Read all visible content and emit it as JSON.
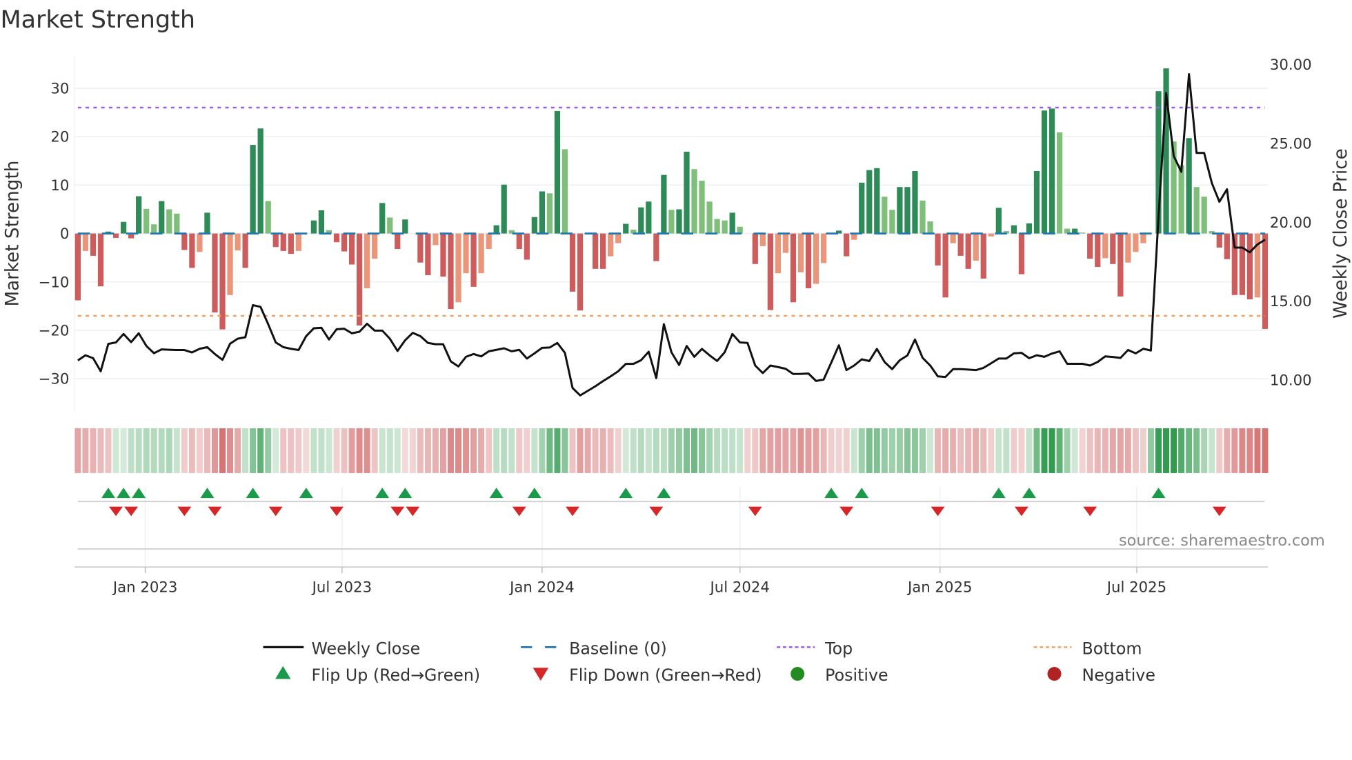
{
  "chart_data": {
    "type": "bar",
    "title": "Market Strength",
    "ylabel": "Market Strength",
    "y2label": "Weekly Close Price",
    "ylim": [
      -36.7,
      36.7
    ],
    "y2lim": [
      8.0,
      30.5
    ],
    "yticks": [
      30,
      20,
      10,
      0,
      -10,
      -20,
      -30
    ],
    "ytick_labels": [
      "30",
      "20",
      "10",
      "0",
      "−10",
      "−20",
      "−30"
    ],
    "y2ticks": [
      30,
      25,
      20,
      15,
      10
    ],
    "y2tick_labels": [
      "30.00",
      "25.00",
      "20.00",
      "15.00",
      "10.00"
    ],
    "x_start_date": "2022-10-31",
    "x_interval_days": 7,
    "xticks": [
      {
        "date": "2023-01-01",
        "label": "Jan 2023"
      },
      {
        "date": "2023-07-01",
        "label": "Jul 2023"
      },
      {
        "date": "2024-01-01",
        "label": "Jan 2024"
      },
      {
        "date": "2024-07-01",
        "label": "Jul 2024"
      },
      {
        "date": "2025-01-01",
        "label": "Jan 2025"
      },
      {
        "date": "2025-07-01",
        "label": "Jul 2025"
      }
    ],
    "grid": true,
    "top_level": 26,
    "bottom_level": -17,
    "baseline": 0,
    "strength": [
      -13.8,
      -3.6,
      -4.6,
      -10.9,
      0.4,
      -0.9,
      2.4,
      -1,
      7.7,
      5.1,
      1.9,
      6.7,
      5,
      4.1,
      -3.4,
      -7.1,
      -3.8,
      4.3,
      -16.3,
      -19.8,
      -12.7,
      -3.5,
      -7.1,
      18.3,
      21.7,
      6.7,
      -2.8,
      -3.6,
      -4.2,
      -3.6,
      0,
      2.7,
      4.8,
      0.7,
      -1.8,
      -3.7,
      -6.4,
      -19,
      -11.3,
      -5.2,
      6.3,
      3.3,
      -3.2,
      2.9,
      0,
      -6,
      -8.6,
      -2.4,
      -8.9,
      -15.6,
      -14.2,
      -8.2,
      -11,
      -8.2,
      -3.2,
      1.7,
      10.1,
      0.7,
      -3.2,
      -5.4,
      3.4,
      8.7,
      8.3,
      25.3,
      17.4,
      -12,
      -15.9,
      0,
      -7.3,
      -7.3,
      -4.7,
      -2,
      2,
      0.8,
      5.4,
      6.6,
      -5.7,
      12.1,
      4.9,
      5,
      16.9,
      13.3,
      10.9,
      6.6,
      3,
      2.7,
      4.3,
      1.4,
      0,
      -6.3,
      -2.6,
      -15.8,
      -8.2,
      -4,
      -14.2,
      -8,
      -11.3,
      -10.4,
      -6.1,
      0,
      0.6,
      -4.7,
      -1.3,
      10.5,
      13.1,
      13.5,
      7.6,
      4.9,
      9.6,
      9.6,
      12.9,
      6.8,
      2.5,
      -6.6,
      -13.2,
      -2,
      -4.6,
      -7.3,
      -5.6,
      -9.3,
      -0.6,
      5.3,
      0.5,
      1.7,
      -8.4,
      2.1,
      12.9,
      25.4,
      25.8,
      20.9,
      1,
      1,
      0.2,
      -5.2,
      -6.9,
      -5.1,
      -6.3,
      -13,
      -6,
      -3.8,
      -2,
      0,
      29.4,
      34.1,
      19,
      14.1,
      19.7,
      9.6,
      7.6,
      0.5,
      -2.9,
      -5.3,
      -12.7,
      -12.7,
      -13.6,
      -13.2,
      -19.7
    ],
    "weekly_close": [
      11.24,
      11.57,
      11.38,
      10.55,
      12.29,
      12.38,
      12.92,
      12.4,
      12.96,
      12.16,
      11.7,
      11.94,
      11.92,
      11.9,
      11.9,
      11.75,
      11.98,
      12.08,
      11.65,
      11.28,
      12.3,
      12.62,
      12.71,
      14.75,
      14.64,
      13.54,
      12.38,
      12.08,
      11.98,
      11.9,
      12.78,
      13.28,
      13.31,
      12.57,
      13.22,
      13.25,
      12.96,
      13.06,
      13.57,
      13.13,
      13.13,
      12.62,
      11.84,
      12.52,
      12.99,
      12.78,
      12.35,
      12.27,
      12.27,
      11.18,
      10.86,
      11.47,
      11.65,
      11.5,
      11.82,
      11.91,
      12.01,
      11.82,
      11.91,
      11.36,
      11.69,
      12.04,
      12.06,
      12.35,
      11.72,
      9.49,
      9.02,
      9.31,
      9.6,
      9.93,
      10.23,
      10.55,
      11.02,
      11.02,
      11.25,
      11.79,
      10.12,
      13.54,
      11.76,
      10.95,
      12.16,
      11.47,
      11.97,
      11.57,
      11.21,
      11.76,
      12.92,
      12.38,
      12.35,
      10.92,
      10.44,
      10.92,
      10.82,
      10.71,
      10.38,
      10.39,
      10.41,
      9.94,
      10.03,
      11.11,
      12.2,
      10.63,
      10.92,
      11.31,
      11.2,
      11.97,
      11.14,
      10.69,
      11.25,
      11.56,
      12.57,
      11.41,
      10.92,
      10.23,
      10.19,
      10.69,
      10.69,
      10.66,
      10.63,
      10.77,
      11.06,
      11.36,
      11.36,
      11.69,
      11.72,
      11.38,
      11.57,
      11.47,
      11.68,
      11.82,
      11.03,
      11.03,
      11.03,
      10.92,
      11.14,
      11.5,
      11.46,
      11.4,
      11.9,
      11.69,
      11.98,
      11.87,
      20.4,
      28.2,
      24.2,
      23.2,
      29.4,
      24.4,
      24.4,
      22.5,
      21.3,
      22.1,
      18.4,
      18.4,
      18.1,
      18.6,
      18.9
    ],
    "flip_up_weeks": [
      4,
      6,
      8,
      17,
      23,
      30,
      40,
      43,
      55,
      60,
      72,
      77,
      99,
      103,
      121,
      125,
      142
    ],
    "flip_down_weeks": [
      5,
      7,
      14,
      18,
      26,
      34,
      42,
      44,
      58,
      65,
      76,
      89,
      101,
      113,
      124,
      133,
      150
    ],
    "legend": [
      {
        "label": "Weekly Close",
        "symbol": "line"
      },
      {
        "label": "Baseline (0)",
        "symbol": "dash"
      },
      {
        "label": "Top",
        "symbol": "dot-purple"
      },
      {
        "label": "Bottom",
        "symbol": "dot-orange"
      },
      {
        "label": "Flip Up (Red→Green)",
        "symbol": "triangle-up"
      },
      {
        "label": "Flip Down (Green→Red)",
        "symbol": "triangle-down"
      },
      {
        "label": "Positive",
        "symbol": "circle-green"
      },
      {
        "label": "Negative",
        "symbol": "circle-red"
      }
    ],
    "legend_position": "bottom-center",
    "source": "source: sharemaestro.com",
    "colors": {
      "up_strong": "#2e8b57",
      "up_weak": "#7fbf7b",
      "down_strong": "#cd5c5c",
      "down_weak": "#e9967a",
      "close": "#111111",
      "baseline": "#1f77b4",
      "top": "#9b5de5",
      "bottom": "#f4a261",
      "flip_up": "#1a9a4a",
      "flip_down": "#d62728",
      "positive": "#228b22",
      "negative": "#b22222"
    }
  }
}
